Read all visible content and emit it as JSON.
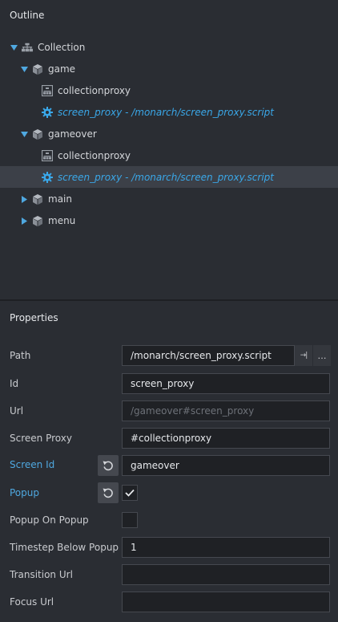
{
  "outline": {
    "title": "Outline",
    "tree": [
      {
        "label": "Collection",
        "icon": "collection-icon",
        "expanded": true
      },
      {
        "label": "game",
        "icon": "game-object-icon",
        "expanded": true
      },
      {
        "label": "collectionproxy",
        "icon": "collection-proxy-icon"
      },
      {
        "label": "screen_proxy - /monarch/screen_proxy.script",
        "icon": "script-gear-icon"
      },
      {
        "label": "gameover",
        "icon": "game-object-icon",
        "expanded": true
      },
      {
        "label": "collectionproxy",
        "icon": "collection-proxy-icon"
      },
      {
        "label": "screen_proxy - /monarch/screen_proxy.script",
        "icon": "script-gear-icon",
        "selected": true
      },
      {
        "label": "main",
        "icon": "game-object-icon",
        "expanded": false
      },
      {
        "label": "menu",
        "icon": "game-object-icon",
        "expanded": false
      }
    ]
  },
  "properties": {
    "title": "Properties",
    "path": {
      "label": "Path",
      "value": "/monarch/screen_proxy.script",
      "goto_glyph": "→|",
      "browse_glyph": "…"
    },
    "id": {
      "label": "Id",
      "value": "screen_proxy"
    },
    "url": {
      "label": "Url",
      "value": "/gameover#screen_proxy"
    },
    "screen_proxy": {
      "label": "Screen Proxy",
      "value": "#collectionproxy"
    },
    "screen_id": {
      "label": "Screen Id",
      "value": "gameover"
    },
    "popup": {
      "label": "Popup",
      "checked": true
    },
    "popup_on_popup": {
      "label": "Popup On Popup",
      "checked": false
    },
    "timestep_below_popup": {
      "label": "Timestep Below Popup",
      "value": "1"
    },
    "transition_url": {
      "label": "Transition Url",
      "value": ""
    },
    "focus_url": {
      "label": "Focus Url",
      "value": ""
    }
  },
  "colors": {
    "background": "#2a2d33",
    "selection": "#3c4048",
    "accent": "#3aa7e8",
    "overridden_label": "#4fa8e0"
  }
}
